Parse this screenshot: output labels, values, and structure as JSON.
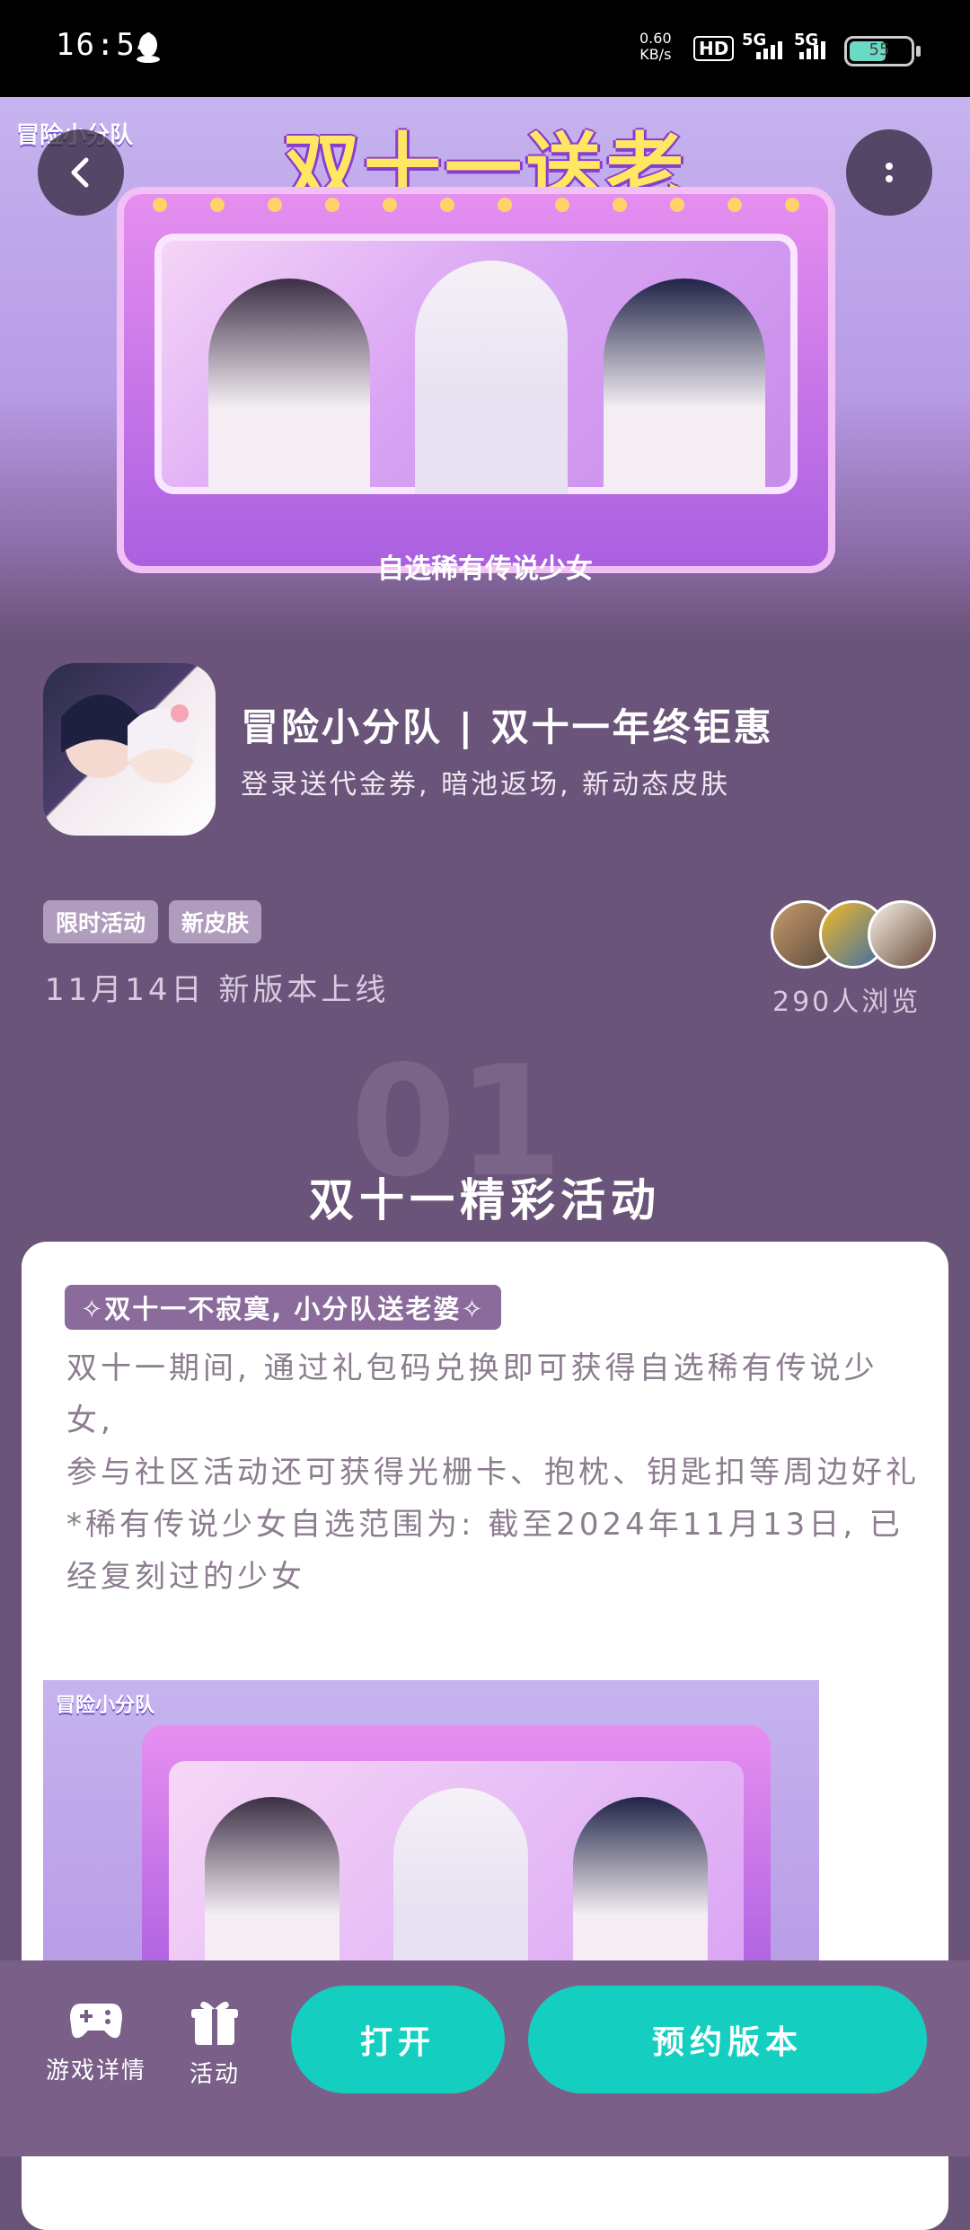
{
  "status_bar": {
    "time": "16:54",
    "net_speed": "0.60",
    "net_speed_unit": "KB/s",
    "hd": "HD",
    "sim1": "5G",
    "sim2": "5G",
    "battery": "55"
  },
  "banner": {
    "logo": "冒险小分队",
    "title": "双十一送老婆!",
    "caption": "自选稀有传说少女"
  },
  "app": {
    "title": "冒险小分队 | 双十一年终钜惠",
    "subtitle": "登录送代金券, 暗池返场, 新动态皮肤",
    "tags": [
      "限时活动",
      "新皮肤"
    ],
    "release": "11月14日 新版本上线",
    "views": "290人浏览"
  },
  "section": {
    "number": "01",
    "title": "双十一精彩活动"
  },
  "card": {
    "tag": "✧双十一不寂寞, 小分队送老婆✧",
    "lines": [
      "双十一期间, 通过礼包码兑换即可获得自选稀有传说少女,",
      "参与社区活动还可获得光栅卡、抱枕、钥匙扣等周边好礼",
      "*稀有传说少女自选范围为: 截至2024年11月13日, 已经复刻过的少女"
    ],
    "image_logo": "冒险小分队"
  },
  "bottom_bar": {
    "game_details": "游戏详情",
    "activity": "活动",
    "open": "打开",
    "reserve": "预约版本"
  },
  "colors": {
    "page_bg": "#6b5479",
    "accent": "#14cfc0",
    "bottom_bar": "#7a6089",
    "tag_bg": "#b09dbd"
  }
}
